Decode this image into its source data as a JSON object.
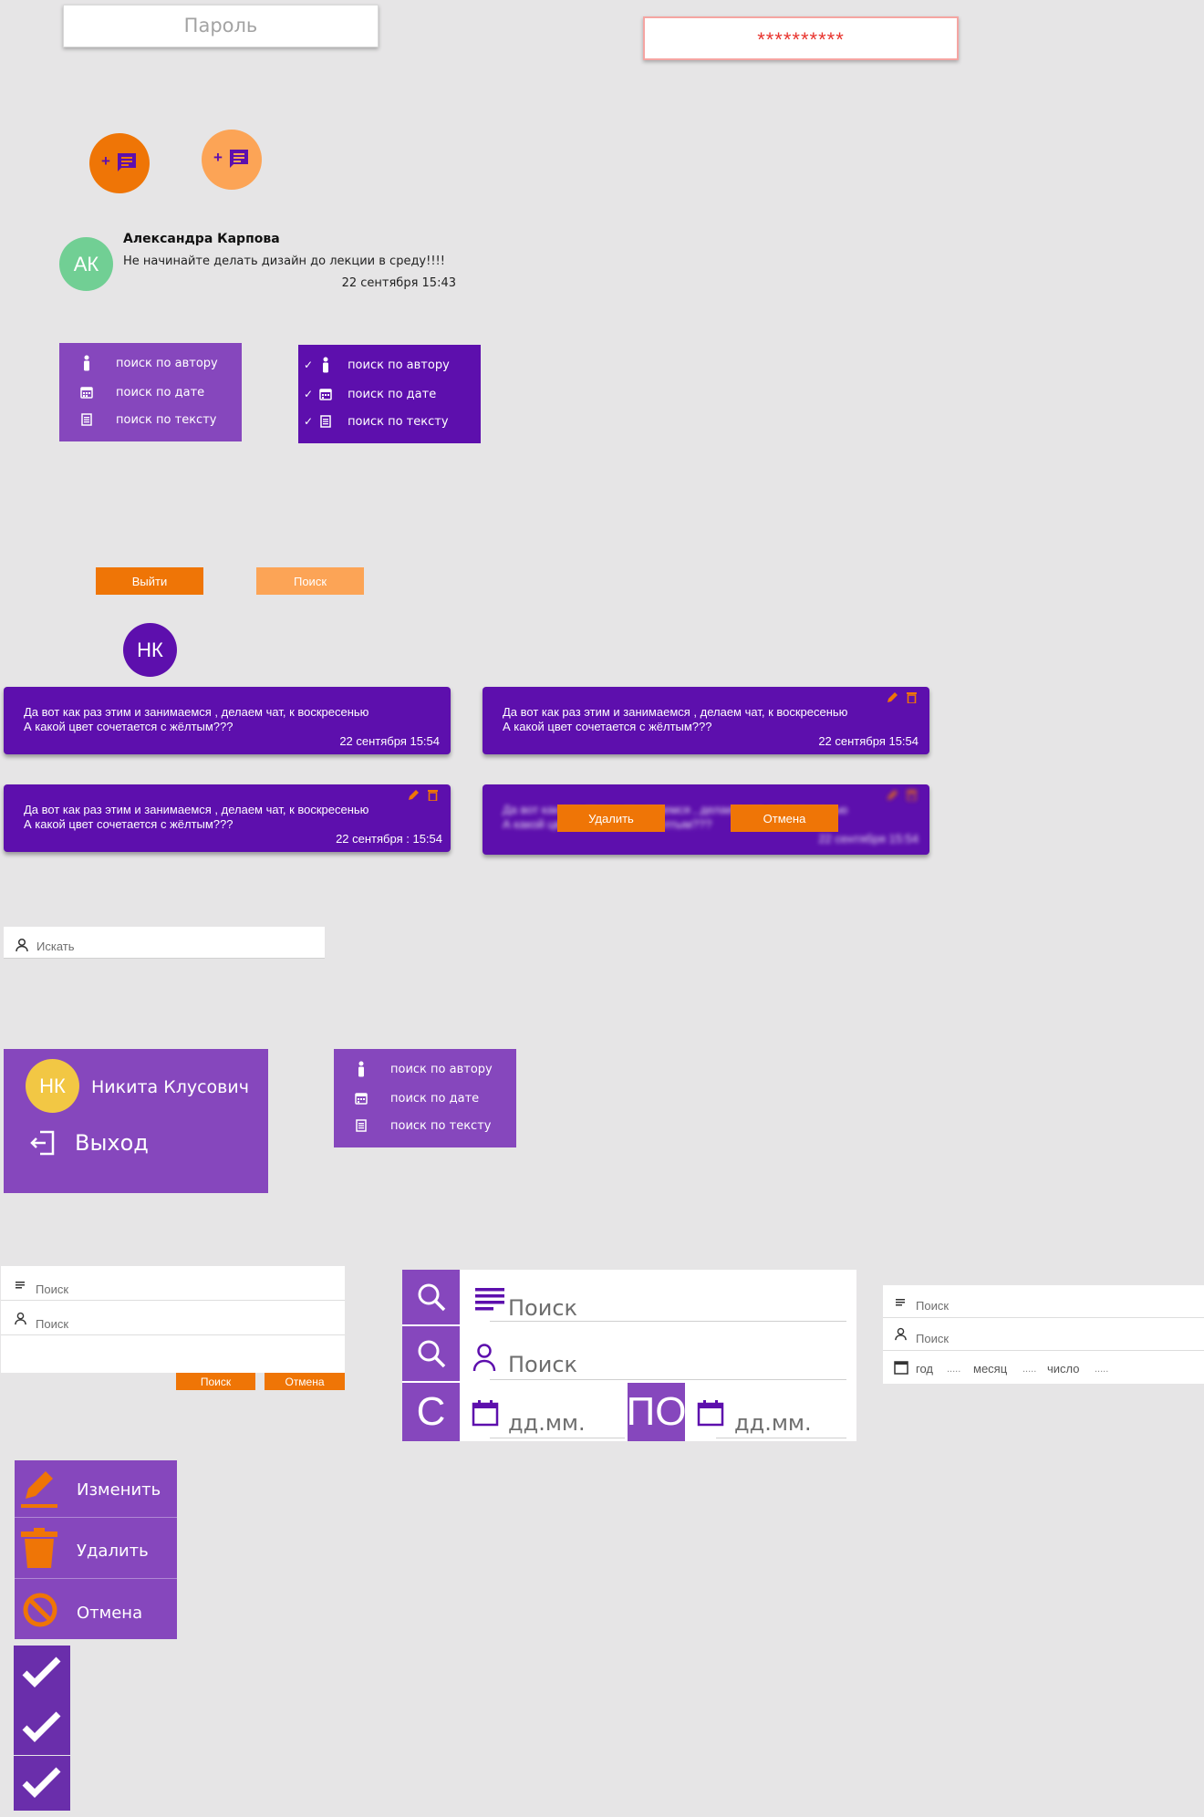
{
  "password_placeholder": "Пароль",
  "password_mask": "**********",
  "fab_plus": "+",
  "message": {
    "avatar": "АК",
    "author": "Александра Карпова",
    "text": "Не начинайте делать дизайн до лекции в среду!!!!",
    "time": "22 сентября 15:43"
  },
  "filter_menu": {
    "items": [
      "поиск по автору",
      "поиск по дате",
      "поиск по  тексту"
    ]
  },
  "buttons": {
    "logout": "Выйти",
    "search": "Поиск"
  },
  "user_avatar": "НК",
  "chat_bubble": {
    "line1": "Да вот как раз этим и занимаемся , делаем чат, к воскресенью",
    "line2": "А какой цвет сочетается с жёлтым???",
    "time_a": "22 сентября  15:54",
    "time_b": "22 сентября 15:54",
    "time_c": "22 сентября : 15:54"
  },
  "confirm": {
    "delete": "Удалить",
    "cancel": "Отмена"
  },
  "search_box": {
    "placeholder": "Искать"
  },
  "profile": {
    "avatar": "НК",
    "name": "Никита Клусович",
    "logout": "Выход"
  },
  "search_form": {
    "text_placeholder": "Поиск",
    "author_placeholder": "Поиск",
    "search": "Поиск",
    "cancel": "Отмена"
  },
  "big_search": {
    "text_placeholder": "Поиск",
    "author_placeholder": "Поиск",
    "from_label": "С",
    "to_label": "ПО",
    "date_placeholder": "дд.мм."
  },
  "date_search": {
    "text_placeholder": "Поиск",
    "author_placeholder": "Поиск",
    "year": "год",
    "month": "месяц",
    "day": "число",
    "dots": "....."
  },
  "action_menu": {
    "edit": "Изменить",
    "delete": "Удалить",
    "cancel": "Отмена"
  },
  "colors": {
    "purple": "#5d0fad",
    "violet": "#8647bd",
    "orange": "#ef7506",
    "light_orange": "#fca456",
    "green": "#71cf94",
    "yellow": "#f2c744",
    "red": "#e8342e"
  }
}
